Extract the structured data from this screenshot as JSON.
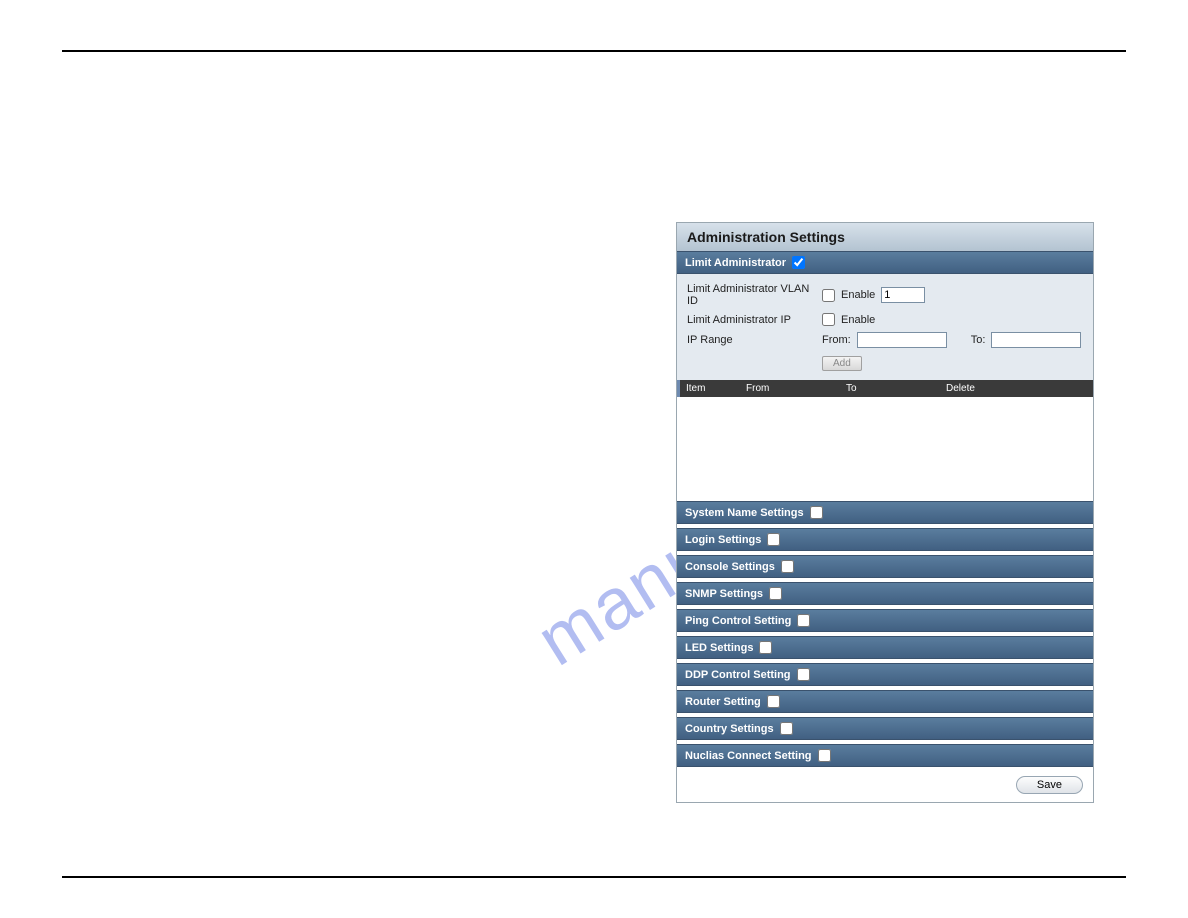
{
  "watermark": "manualshive.com",
  "panel": {
    "title": "Administration Settings",
    "limit_admin": {
      "header": "Limit Administrator",
      "header_checked": true,
      "vlan_label": "Limit Administrator VLAN ID",
      "vlan_enable": "Enable",
      "vlan_value": "1",
      "ip_label": "Limit Administrator IP",
      "ip_enable": "Enable",
      "range_label": "IP Range",
      "from": "From:",
      "to": "To:",
      "add": "Add",
      "table": {
        "item": "Item",
        "from": "From",
        "to": "To",
        "delete": "Delete"
      }
    },
    "sections": [
      {
        "label": "System Name Settings"
      },
      {
        "label": "Login Settings"
      },
      {
        "label": "Console Settings"
      },
      {
        "label": "SNMP Settings"
      },
      {
        "label": "Ping Control Setting"
      },
      {
        "label": "LED Settings"
      },
      {
        "label": "DDP Control Setting"
      },
      {
        "label": "Router Setting"
      },
      {
        "label": "Country Settings"
      },
      {
        "label": "Nuclias Connect Setting"
      }
    ],
    "save": "Save"
  }
}
